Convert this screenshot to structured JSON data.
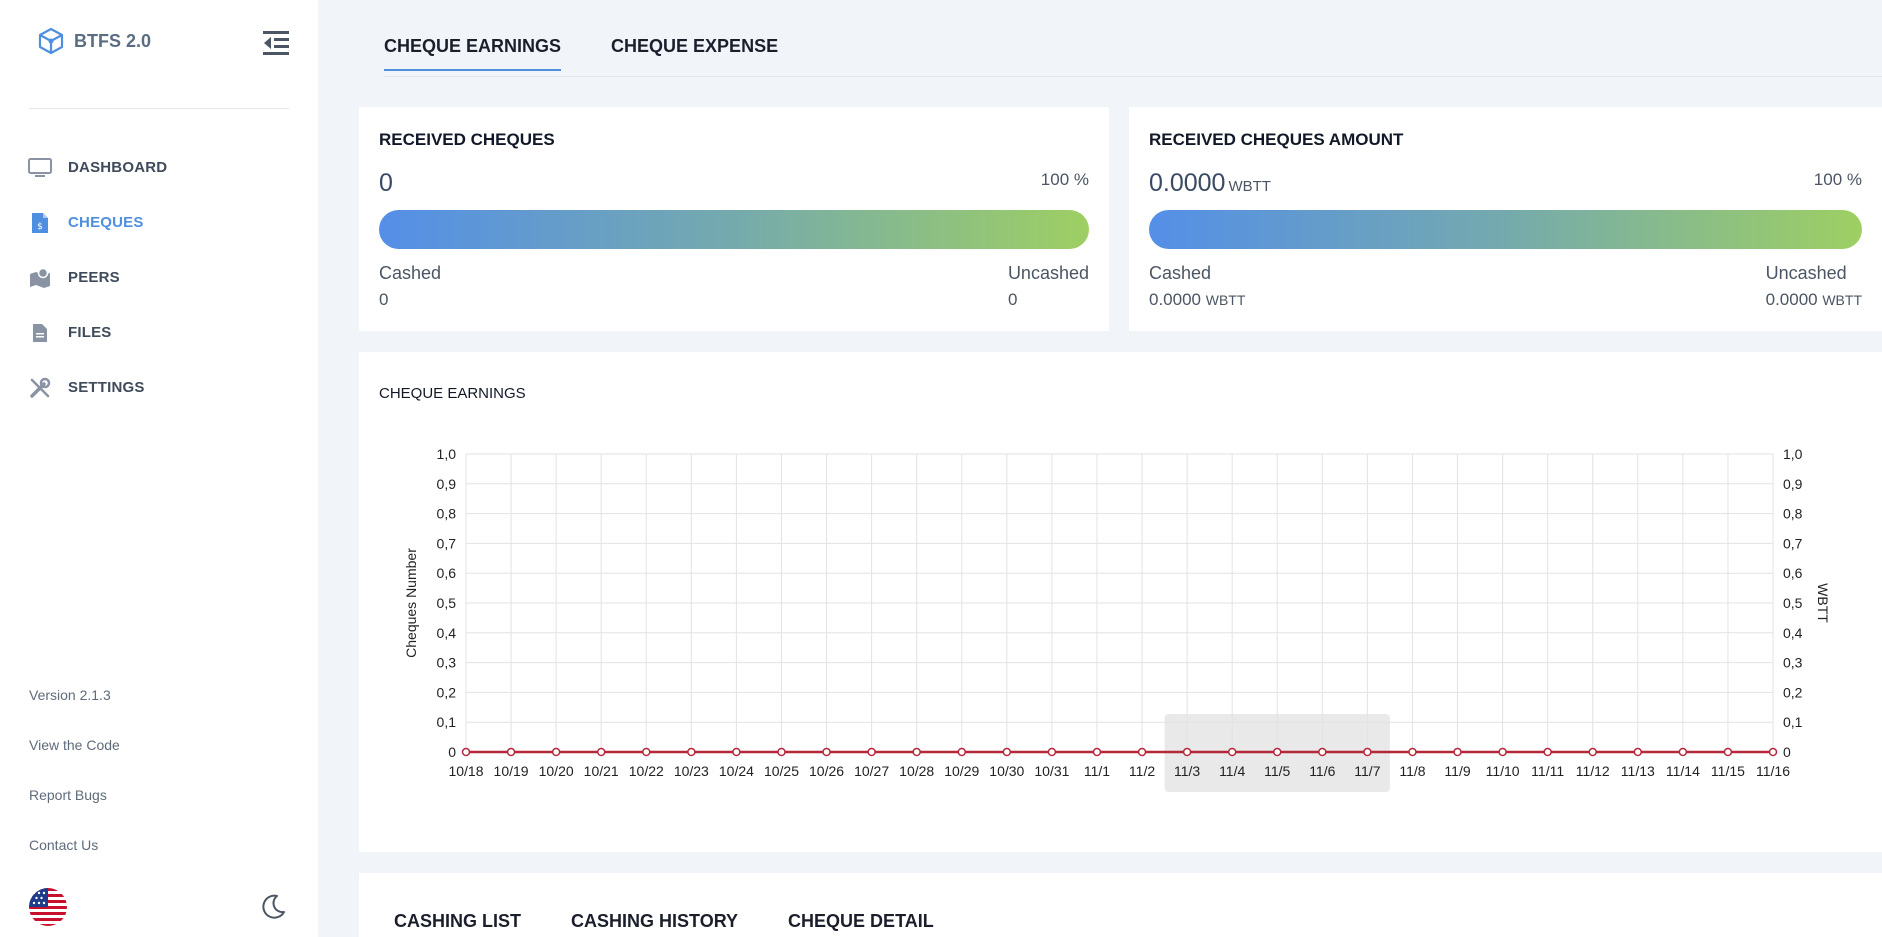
{
  "app": {
    "name": "BTFS 2.0"
  },
  "sidebar": {
    "items": [
      {
        "label": "DASHBOARD",
        "icon": "monitor-icon"
      },
      {
        "label": "CHEQUES",
        "icon": "cheque-file-icon",
        "active": true
      },
      {
        "label": "PEERS",
        "icon": "map-icon"
      },
      {
        "label": "FILES",
        "icon": "file-icon"
      },
      {
        "label": "SETTINGS",
        "icon": "tools-icon"
      }
    ],
    "footer": {
      "version": "Version 2.1.3",
      "view_code": "View the Code",
      "report_bugs": "Report Bugs",
      "contact": "Contact Us"
    }
  },
  "tabs": [
    "CHEQUE EARNINGS",
    "CHEQUE EXPENSE"
  ],
  "received_cheques": {
    "title": "RECEIVED CHEQUES",
    "value": "0",
    "percent": "100 %",
    "progress": 1.0,
    "cashed_label": "Cashed",
    "cashed_value": "0",
    "uncashed_label": "Uncashed",
    "uncashed_value": "0"
  },
  "received_amount": {
    "title": "RECEIVED CHEQUES AMOUNT",
    "value": "0.0000",
    "unit": "WBTT",
    "percent": "100 %",
    "progress": 1.0,
    "cashed_label": "Cashed",
    "cashed_value": "0.0000",
    "cashed_unit": "WBTT",
    "uncashed_label": "Uncashed",
    "uncashed_value": "0.0000",
    "uncashed_unit": "WBTT"
  },
  "chart": {
    "title": "CHEQUE EARNINGS"
  },
  "chart_data": {
    "type": "line",
    "title": "CHEQUE EARNINGS",
    "xlabel": "",
    "ylabel": "Cheques Number",
    "y2label": "WBTT",
    "ylim": [
      0,
      1
    ],
    "y2lim": [
      0,
      1
    ],
    "yticks": [
      "0",
      "0,1",
      "0,2",
      "0,3",
      "0,4",
      "0,5",
      "0,6",
      "0,7",
      "0,8",
      "0,9",
      "1,0"
    ],
    "categories": [
      "10/18",
      "10/19",
      "10/20",
      "10/21",
      "10/22",
      "10/23",
      "10/24",
      "10/25",
      "10/26",
      "10/27",
      "10/28",
      "10/29",
      "10/30",
      "10/31",
      "11/1",
      "11/2",
      "11/3",
      "11/4",
      "11/5",
      "11/6",
      "11/7",
      "11/8",
      "11/9",
      "11/10",
      "11/11",
      "11/12",
      "11/13",
      "11/14",
      "11/15",
      "11/16"
    ],
    "series": [
      {
        "values": [
          0,
          0,
          0,
          0,
          0,
          0,
          0,
          0,
          0,
          0,
          0,
          0,
          0,
          0,
          0,
          0,
          0,
          0,
          0,
          0,
          0,
          0,
          0,
          0,
          0,
          0,
          0,
          0,
          0,
          0
        ],
        "color": "#b5273a"
      }
    ],
    "highlight_range": [
      "11/3",
      "11/7"
    ],
    "grid": true
  },
  "bottom_tabs": [
    "CASHING LIST",
    "CASHING HISTORY",
    "CHEQUE DETAIL"
  ],
  "colors": {
    "accent": "#4e8fe0",
    "gradient_start": "#548fe8",
    "gradient_end": "#9ecf63",
    "line": "#b5273a"
  }
}
